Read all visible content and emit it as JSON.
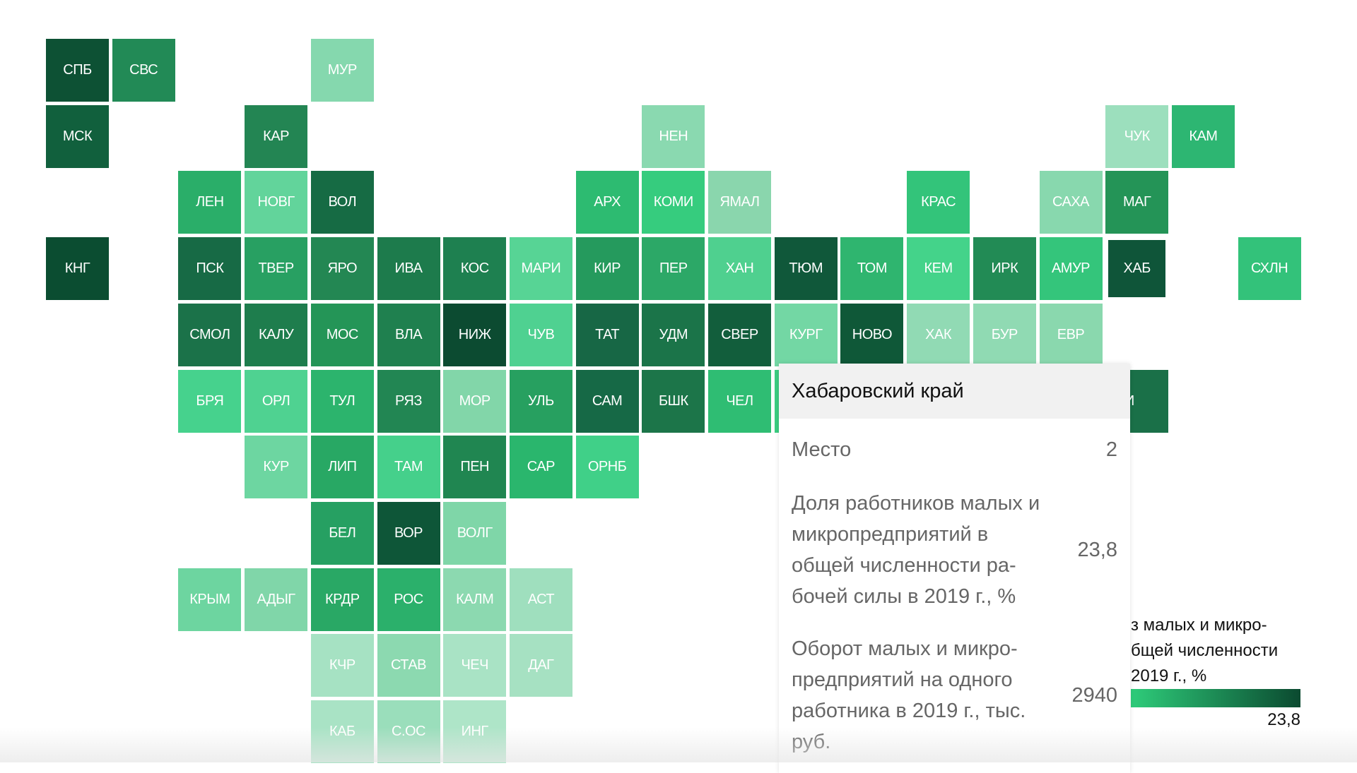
{
  "map": {
    "tiles": [
      {
        "code": "СПБ",
        "color": "#0d5134"
      },
      {
        "code": "СВС",
        "color": "#228a56"
      },
      {
        "code": "МУР",
        "color": "#85d8ae"
      },
      {
        "code": "МСК",
        "color": "#11603d"
      },
      {
        "code": "КАР",
        "color": "#238553"
      },
      {
        "code": "НЕН",
        "color": "#8ad9b0"
      },
      {
        "code": "ЧУК",
        "color": "#9cdfbd"
      },
      {
        "code": "КАМ",
        "color": "#2db672"
      },
      {
        "code": "ЛЕН",
        "color": "#2aae69"
      },
      {
        "code": "НОВГ",
        "color": "#62d49b"
      },
      {
        "code": "ВОЛ",
        "color": "#166b44"
      },
      {
        "code": "АРХ",
        "color": "#2dbb71"
      },
      {
        "code": "КОМИ",
        "color": "#36cc7e"
      },
      {
        "code": "ЯМАЛ",
        "color": "#8ad6ad"
      },
      {
        "code": "КРАС",
        "color": "#33c47a"
      },
      {
        "code": "САХА",
        "color": "#88d8ae"
      },
      {
        "code": "МАГ",
        "color": "#249457"
      },
      {
        "code": "КНГ",
        "color": "#0b4d31"
      },
      {
        "code": "ПСК",
        "color": "#176a45"
      },
      {
        "code": "ТВЕР",
        "color": "#28a062"
      },
      {
        "code": "ЯРО",
        "color": "#238753"
      },
      {
        "code": "ИВА",
        "color": "#1d7b4c"
      },
      {
        "code": "КОС",
        "color": "#1e8050"
      },
      {
        "code": "МАРИ",
        "color": "#57d495"
      },
      {
        "code": "КИР",
        "color": "#259a5d"
      },
      {
        "code": "ПЕР",
        "color": "#2ca867"
      },
      {
        "code": "ХАН",
        "color": "#4fd08f"
      },
      {
        "code": "ТЮМ",
        "color": "#10583a"
      },
      {
        "code": "ТОМ",
        "color": "#2fb56f"
      },
      {
        "code": "КЕМ",
        "color": "#44d38a"
      },
      {
        "code": "ИРК",
        "color": "#228b55"
      },
      {
        "code": "АМУР",
        "color": "#34c57b"
      },
      {
        "code": "ХАБ",
        "color": "#0f5539"
      },
      {
        "code": "СХЛН",
        "color": "#33c27a"
      },
      {
        "code": "СМОЛ",
        "color": "#1b7249"
      },
      {
        "code": "КАЛУ",
        "color": "#1e7d4d"
      },
      {
        "code": "МОС",
        "color": "#249557"
      },
      {
        "code": "ВЛА",
        "color": "#1f804f"
      },
      {
        "code": "НИЖ",
        "color": "#0c4b31"
      },
      {
        "code": "ЧУВ",
        "color": "#4fd191"
      },
      {
        "code": "ТАТ",
        "color": "#176745"
      },
      {
        "code": "УДМ",
        "color": "#1b7449"
      },
      {
        "code": "СВЕР",
        "color": "#125e3c"
      },
      {
        "code": "КУРГ",
        "color": "#73d7a4"
      },
      {
        "code": "НОВО",
        "color": "#0f5838"
      },
      {
        "code": "ХАК",
        "color": "#91dab4"
      },
      {
        "code": "БУР",
        "color": "#90dab3"
      },
      {
        "code": "ЕВР",
        "color": "#8ad8ae"
      },
      {
        "code": "БРЯ",
        "color": "#46d28d"
      },
      {
        "code": "ОРЛ",
        "color": "#4fd291"
      },
      {
        "code": "ТУЛ",
        "color": "#2cb46d"
      },
      {
        "code": "РЯЗ",
        "color": "#228653"
      },
      {
        "code": "МОР",
        "color": "#82d6a9"
      },
      {
        "code": "УЛЬ",
        "color": "#27a060"
      },
      {
        "code": "САМ",
        "color": "#166946"
      },
      {
        "code": "БШК",
        "color": "#1c7549"
      },
      {
        "code": "ЧЕЛ",
        "color": "#2fbd73"
      },
      {
        "code": "",
        "color": "#3bcd80"
      },
      {
        "code": "ПРИ",
        "color": "#1a7048"
      },
      {
        "code": "КУР",
        "color": "#6dd6a1"
      },
      {
        "code": "ЛИП",
        "color": "#28a864"
      },
      {
        "code": "ТАМ",
        "color": "#45d08b"
      },
      {
        "code": "ПЕН",
        "color": "#208651"
      },
      {
        "code": "САР",
        "color": "#2ab66d"
      },
      {
        "code": "ОРНБ",
        "color": "#40d088"
      },
      {
        "code": "БЕЛ",
        "color": "#26a062"
      },
      {
        "code": "ВОР",
        "color": "#0e5638"
      },
      {
        "code": "ВОЛГ",
        "color": "#7fd6a8"
      },
      {
        "code": "КРЫМ",
        "color": "#6dd5a0"
      },
      {
        "code": "АДЫГ",
        "color": "#80d6a9"
      },
      {
        "code": "КРДР",
        "color": "#29a865"
      },
      {
        "code": "РОС",
        "color": "#2bb06b"
      },
      {
        "code": "КАЛМ",
        "color": "#8cd9b0"
      },
      {
        "code": "АСТ",
        "color": "#9fdfbe"
      },
      {
        "code": "КЧР",
        "color": "#a6e2c3"
      },
      {
        "code": "СТАВ",
        "color": "#8cd9b0"
      },
      {
        "code": "ЧЕЧ",
        "color": "#a9e3c5"
      },
      {
        "code": "ДАГ",
        "color": "#a6e1c2"
      },
      {
        "code": "КАБ",
        "color": "#a9e3c5"
      },
      {
        "code": "С.ОС",
        "color": "#9adebb"
      },
      {
        "code": "ИНГ",
        "color": "#aee5c8"
      }
    ],
    "hovered": "ХАБ"
  },
  "tooltip": {
    "title": "Хабаровский край",
    "rows": [
      {
        "label": "Место",
        "value": "2"
      },
      {
        "label": "Доля работников малых и микропредприятий в общей численности ра-бочей силы в 2019 г., %",
        "value": "23,8"
      },
      {
        "label": "Оборот малых и микро-предприятий на одного работника в 2019 г., тыс. руб.",
        "value": "2940"
      }
    ]
  },
  "legend": {
    "title_visible": "з малых и микро- бщей численности 2019 г., %",
    "max_label": "23,8",
    "gradient": [
      "#2ecc7a",
      "#0b4a30"
    ]
  }
}
